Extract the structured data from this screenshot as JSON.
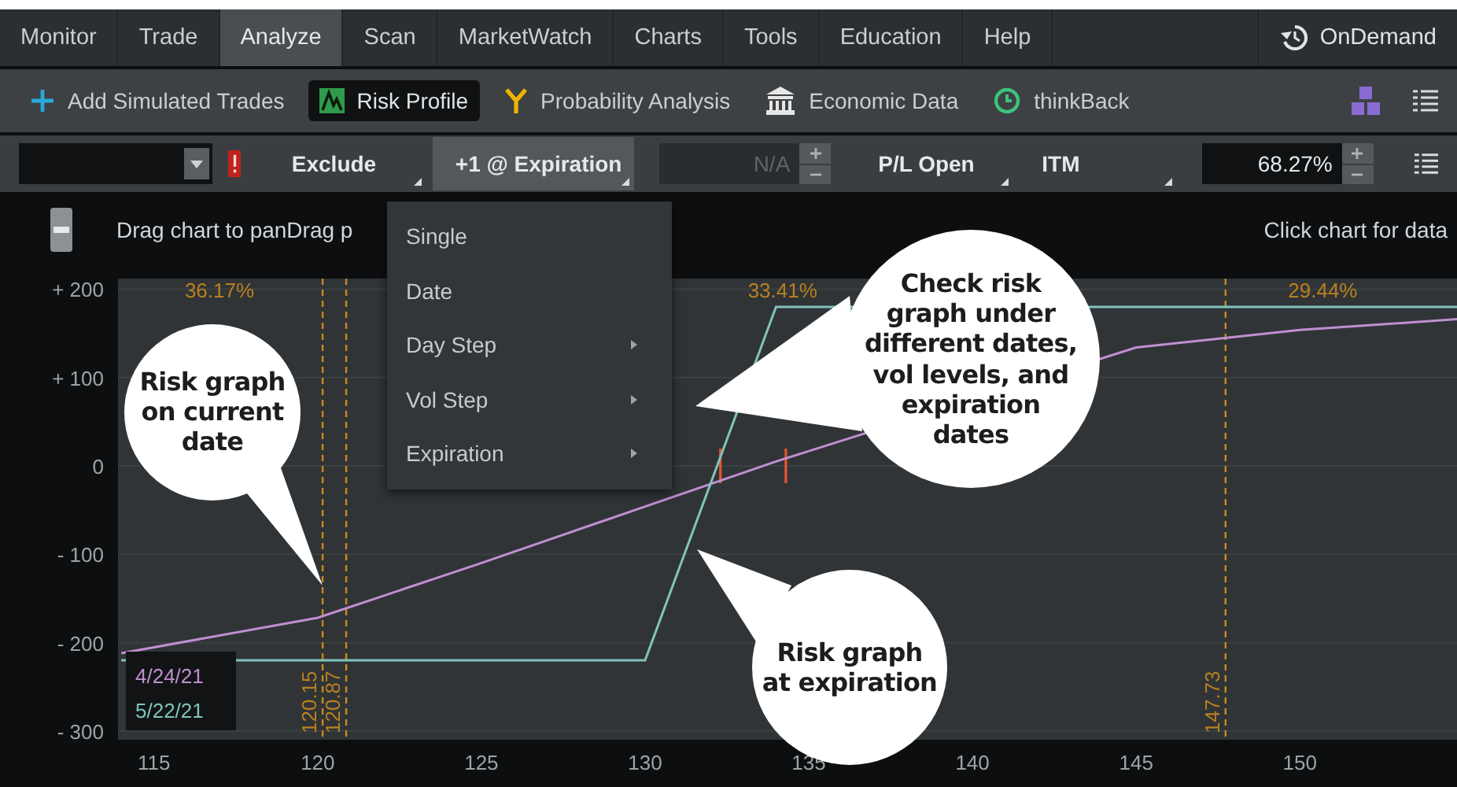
{
  "nav": {
    "tabs": [
      {
        "label": "Monitor",
        "selected": false
      },
      {
        "label": "Trade",
        "selected": false
      },
      {
        "label": "Analyze",
        "selected": true
      },
      {
        "label": "Scan",
        "selected": false
      },
      {
        "label": "MarketWatch",
        "selected": false
      },
      {
        "label": "Charts",
        "selected": false
      },
      {
        "label": "Tools",
        "selected": false
      },
      {
        "label": "Education",
        "selected": false
      },
      {
        "label": "Help",
        "selected": false
      }
    ],
    "ondemand": "OnDemand"
  },
  "toolbar": [
    {
      "kind": "add",
      "label": "Add Simulated Trades",
      "selected": false
    },
    {
      "kind": "risk",
      "label": "Risk Profile",
      "selected": true
    },
    {
      "kind": "probability",
      "label": "Probability Analysis",
      "selected": false
    },
    {
      "kind": "economic",
      "label": "Economic Data",
      "selected": false
    },
    {
      "kind": "thinkback",
      "label": "thinkBack",
      "selected": false
    }
  ],
  "controls": [
    {
      "kind": "dropdown",
      "label": "Exclude",
      "open": false
    },
    {
      "kind": "dropdown",
      "label": "+1 @ Expiration",
      "open": true
    },
    {
      "kind": "spinner",
      "value": "N/A",
      "disabled": true
    },
    {
      "kind": "dropdown",
      "label": "P/L Open",
      "open": false
    },
    {
      "kind": "dropdown",
      "label": "ITM",
      "open": false
    },
    {
      "kind": "spinner",
      "value": "68.27%",
      "disabled": false
    }
  ],
  "info": {
    "hint": "Drag chart to panDrag p",
    "right_hint": "Click chart for data"
  },
  "menu": [
    {
      "label": "Single",
      "submenu": false
    },
    {
      "label": "Date",
      "submenu": false
    },
    {
      "label": "Day Step",
      "submenu": true
    },
    {
      "label": "Vol Step",
      "submenu": true
    },
    {
      "label": "Expiration",
      "submenu": true
    }
  ],
  "chart": {
    "probability_labels": [
      "36.17%",
      "33.41%",
      "29.44%"
    ],
    "chart_data": {
      "type": "line",
      "x": [
        114,
        120,
        125,
        130,
        134,
        145,
        150,
        154.8
      ],
      "series": [
        {
          "name": "4/24/21",
          "color": "#c08fd0",
          "values": [
            -212,
            -172,
            -110,
            -46,
            5,
            134,
            154,
            166
          ]
        },
        {
          "name": "5/22/21",
          "color": "#7fc4bc",
          "values": [
            -220,
            -220,
            -220,
            -220,
            180,
            180,
            180,
            180
          ]
        }
      ],
      "grid": true,
      "xlim": [
        113.9,
        154.8
      ],
      "ylim": [
        -310,
        212
      ],
      "xticks": [
        115,
        120,
        125,
        130,
        135,
        140,
        145,
        150
      ],
      "yticks": [
        {
          "value": 200,
          "label": "+ 200"
        },
        {
          "value": 100,
          "label": "+ 100"
        },
        {
          "value": 0,
          "label": "0"
        },
        {
          "value": -100,
          "label": "- 100"
        },
        {
          "value": -200,
          "label": "- 200"
        },
        {
          "value": -300,
          "label": "- 300"
        }
      ],
      "ref_lines": [
        {
          "axis": "x",
          "value": 120.15,
          "label": "120.15"
        },
        {
          "axis": "x",
          "value": 120.87,
          "label": "120.87"
        },
        {
          "axis": "x",
          "value": 147.73,
          "label": "147.73"
        }
      ]
    }
  },
  "callouts": [
    "Risk graph on current date",
    "Check risk graph under different dates, vol levels, and expiration dates",
    "Risk graph at expiration"
  ]
}
